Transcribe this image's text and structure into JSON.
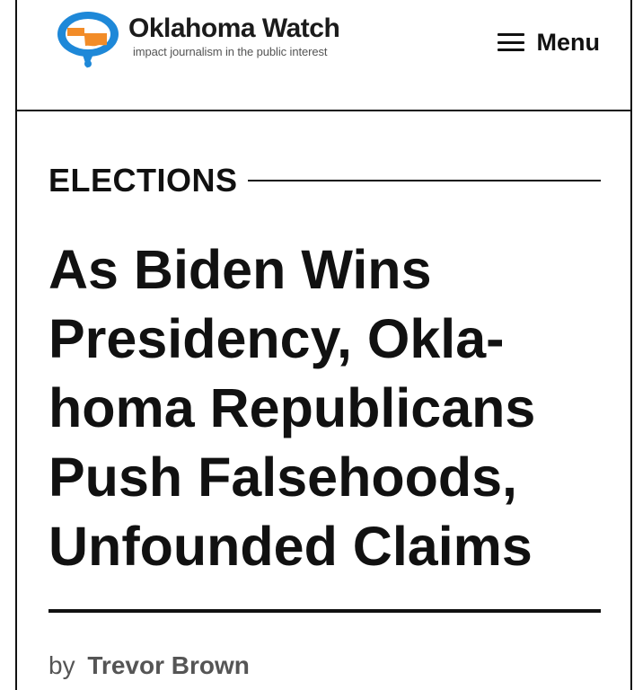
{
  "header": {
    "logo": {
      "name": "Oklahoma Watch",
      "tagline": "impact journalism in the public interest",
      "icon": "speech-bubble-oklahoma-map-icon",
      "colors": {
        "bubble": "#1e88d8",
        "map": "#f28c28",
        "text": "#1b1b1b"
      }
    },
    "menu": {
      "icon": "hamburger-icon",
      "label": "Menu"
    }
  },
  "article": {
    "category": "ELECTIONS",
    "headline_lines": [
      "As Biden Wins",
      "Presidency, Okla-",
      "homa Republicans",
      "Push Falsehoods,",
      "Unfounded Claims"
    ],
    "byline": {
      "prefix": "by",
      "author": "Trevor Brown"
    }
  }
}
